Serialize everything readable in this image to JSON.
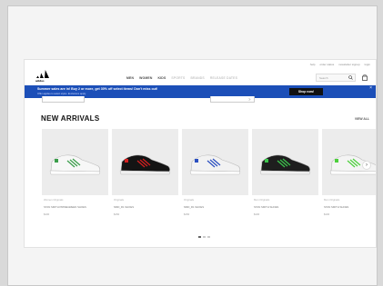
{
  "utility_links": [
    "help",
    "order status",
    "newsletter signup",
    "login"
  ],
  "logo": {
    "text": "adidas"
  },
  "nav": [
    {
      "label": "MEN",
      "muted": false
    },
    {
      "label": "WOMEN",
      "muted": false
    },
    {
      "label": "KIDS",
      "muted": false
    },
    {
      "label": "SPORTS",
      "muted": true
    },
    {
      "label": "BRANDS",
      "muted": true
    },
    {
      "label": "RELEASE DATES",
      "muted": true
    }
  ],
  "search": {
    "placeholder": "Search"
  },
  "banner": {
    "title": "Summer sales are in! Buy 2 or more, get 30% off select items! Don't miss out!",
    "subtitle": "Offer applies to select styles. Exclusions apply.",
    "button": "Shop now!",
    "close": "×"
  },
  "section": {
    "title": "NEW ARRIVALS",
    "view_all": "VIEW ALL"
  },
  "products": [
    {
      "tag": "Women Originals",
      "name": "STAN SMITH PRIMEGREEN SHOES",
      "price": "$100",
      "shoe_color": "#f7f7f7",
      "accent": "#3a9d4a"
    },
    {
      "tag": "Originals",
      "name": "NMD_R1 SHOES",
      "price": "$150",
      "shoe_color": "#141414",
      "accent": "#d42020"
    },
    {
      "tag": "Originals",
      "name": "NMD_R1 SHOES",
      "price": "$150",
      "shoe_color": "#f2f2f2",
      "accent": "#2a4fc0"
    },
    {
      "tag": "Men Originals",
      "name": "STAN SMITH SHOES",
      "price": "$100",
      "shoe_color": "#1e1e1e",
      "accent": "#3cc44c"
    },
    {
      "tag": "Men Originals",
      "name": "STAN SMITH SHOES",
      "price": "$100",
      "shoe_color": "#f4f4f4",
      "accent": "#4ccf3c"
    }
  ],
  "carousel": {
    "next": "›",
    "dots": 3,
    "active": 0
  }
}
